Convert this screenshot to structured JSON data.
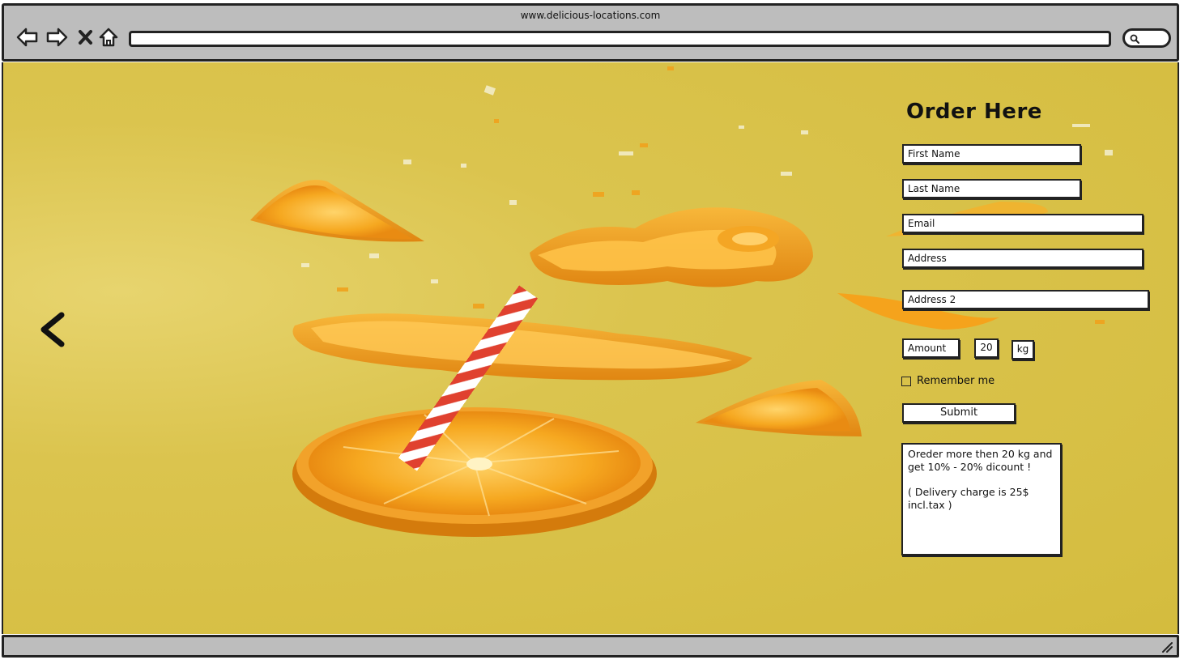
{
  "browser": {
    "url": "www.delicious-locations.com"
  },
  "colors": {
    "background": "#d8c146",
    "orange": "#f2a31c",
    "chrome": "#bdbdbd"
  },
  "carousel": {
    "prev_icon": "chevron-left-icon"
  },
  "order_form": {
    "title": "Order Here",
    "first_name_placeholder": "First Name",
    "last_name_placeholder": "Last Name",
    "email_placeholder": "Email",
    "address_placeholder": "Address",
    "address2_placeholder": "Address 2",
    "amount_label": "Amount",
    "amount_value": "20",
    "unit": "kg",
    "remember_label": "Remember me",
    "submit_label": "Submit",
    "note_line1": "Oreder more then 20 kg and get 10% - 20% dicount !",
    "note_line2": "( Delivery charge is 25$ incl.tax )"
  }
}
